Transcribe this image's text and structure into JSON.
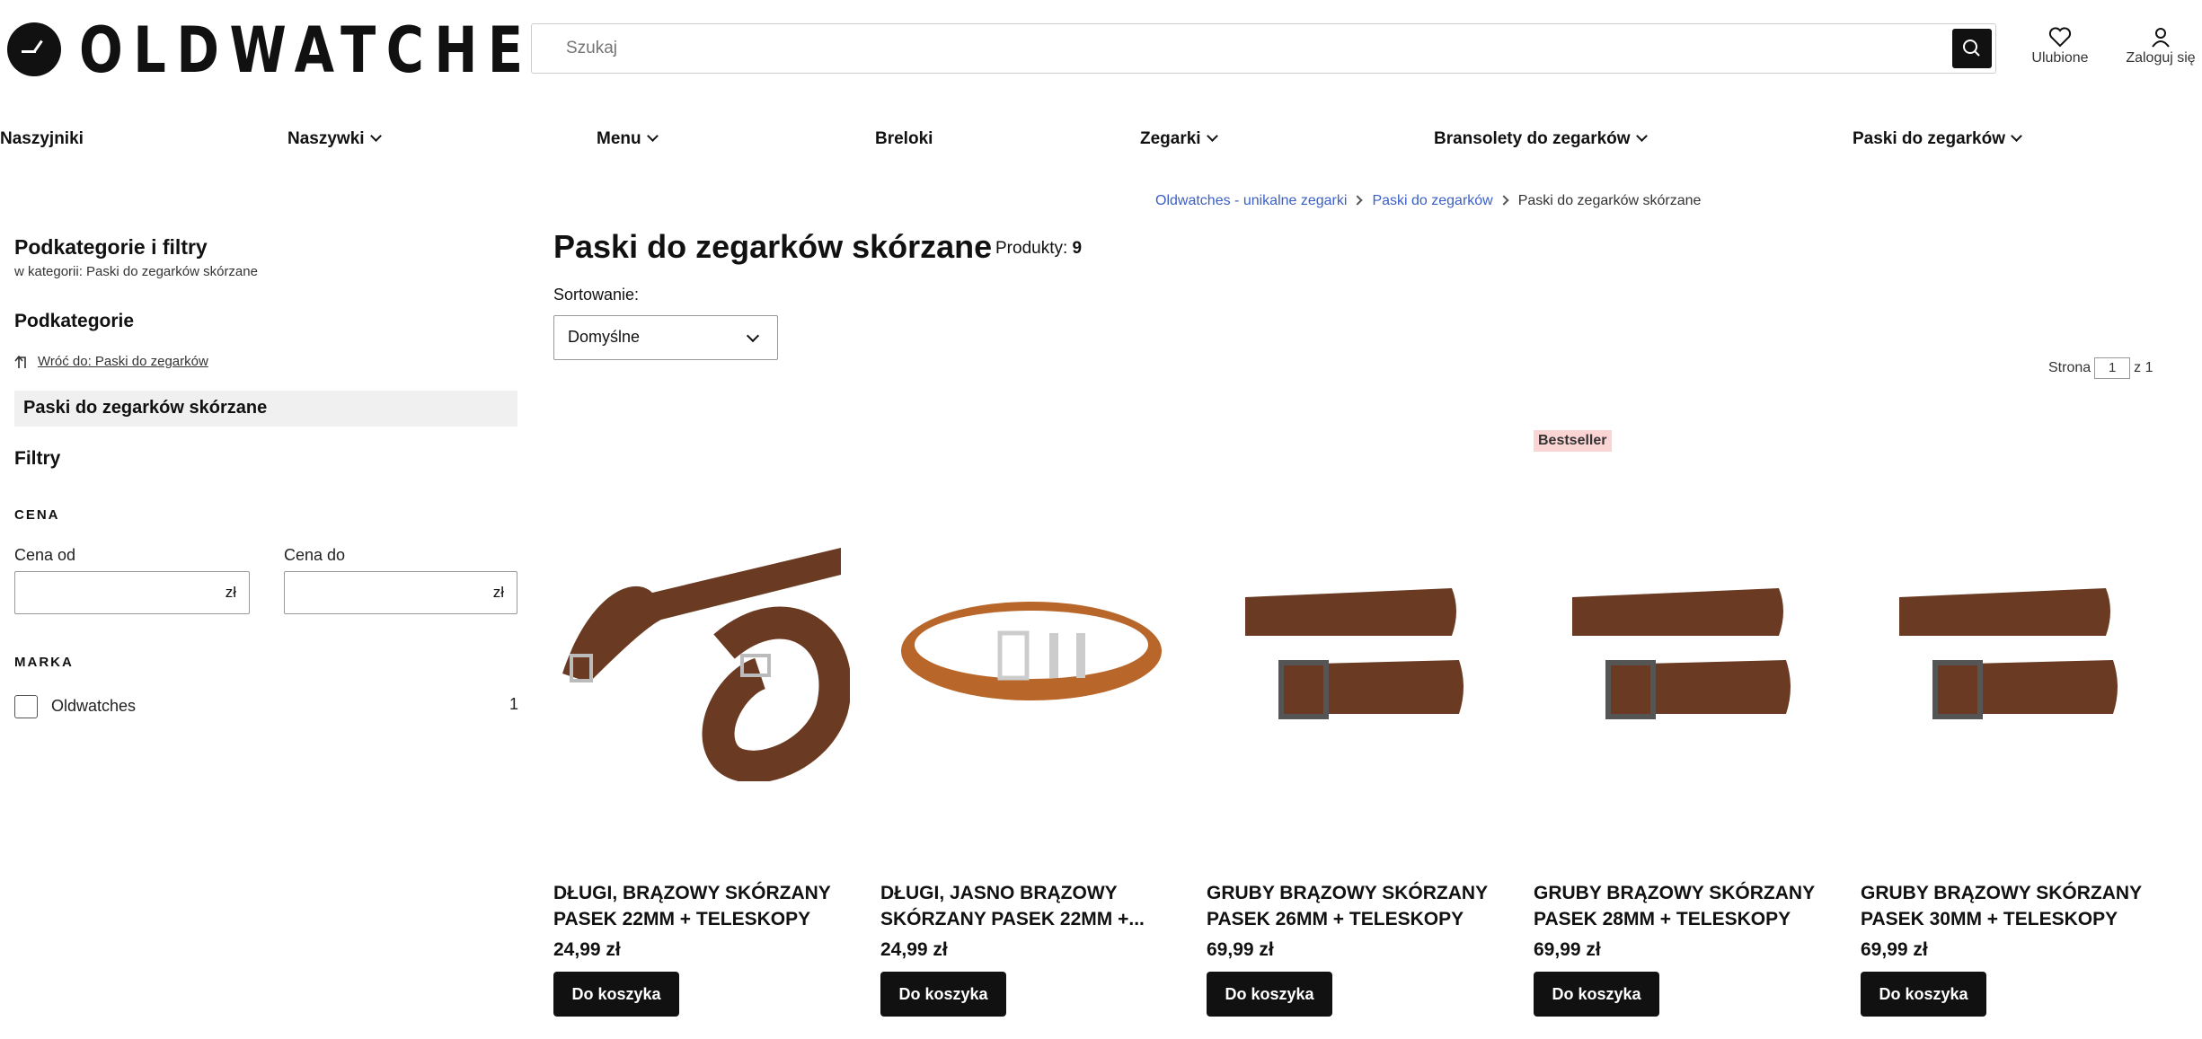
{
  "header": {
    "logo": "OLDWATCHES",
    "search_placeholder": "Szukaj",
    "favorites": "Ulubione",
    "login": "Zaloguj się"
  },
  "nav": [
    "Naszyjniki",
    "Naszywki",
    "Menu",
    "Breloki",
    "Zegarki",
    "Bransolety do zegarków",
    "Paski do zegarków"
  ],
  "breadcrumb": {
    "home": "Oldwatches - unikalne zegarki",
    "parent": "Paski do zegarków",
    "current": "Paski do zegarków skórzane"
  },
  "sidebar": {
    "title": "Podkategorie i filtry",
    "subtitle": "w kategorii: Paski do zegarków skórzane",
    "subcategories_heading": "Podkategorie",
    "back_link": "Wróć do: Paski do zegarków",
    "active_category": "Paski do zegarków skórzane",
    "filters_heading": "Filtry",
    "price_heading": "CENA",
    "price_from": "Cena od",
    "price_to": "Cena do",
    "currency": "zł",
    "brand_heading": "MARKA",
    "brand_name": "Oldwatches",
    "brand_count": "1"
  },
  "main": {
    "title": "Paski do zegarków skórzane",
    "products_label": "Produkty:",
    "products_count": "9",
    "sort_label": "Sortowanie:",
    "sort_value": "Domyślne",
    "page_label": "Strona",
    "page_current": "1",
    "page_total": "z 1"
  },
  "products": [
    {
      "name": "DŁUGI, BRĄZOWY SKÓRZANY PASEK 22MM + TELESKOPY",
      "price": "24,99 zł",
      "button": "Do koszyka",
      "badge": ""
    },
    {
      "name": "DŁUGI, JASNO BRĄZOWY SKÓRZANY PASEK 22MM +...",
      "price": "24,99 zł",
      "button": "Do koszyka",
      "badge": ""
    },
    {
      "name": "GRUBY BRĄZOWY SKÓRZANY PASEK 26MM + TELESKOPY +...",
      "price": "69,99 zł",
      "button": "Do koszyka",
      "badge": ""
    },
    {
      "name": "GRUBY BRĄZOWY SKÓRZANY PASEK 28MM + TELESKOPY +...",
      "price": "69,99 zł",
      "button": "Do koszyka",
      "badge": "Bestseller"
    },
    {
      "name": "GRUBY BRĄZOWY SKÓRZANY PASEK 30MM + TELESKOPY +...",
      "price": "69,99 zł",
      "button": "Do koszyka",
      "badge": ""
    }
  ],
  "colors": {
    "accent": "#111111",
    "link": "#3b5fc4",
    "badge_bg": "#fbd4d4"
  }
}
